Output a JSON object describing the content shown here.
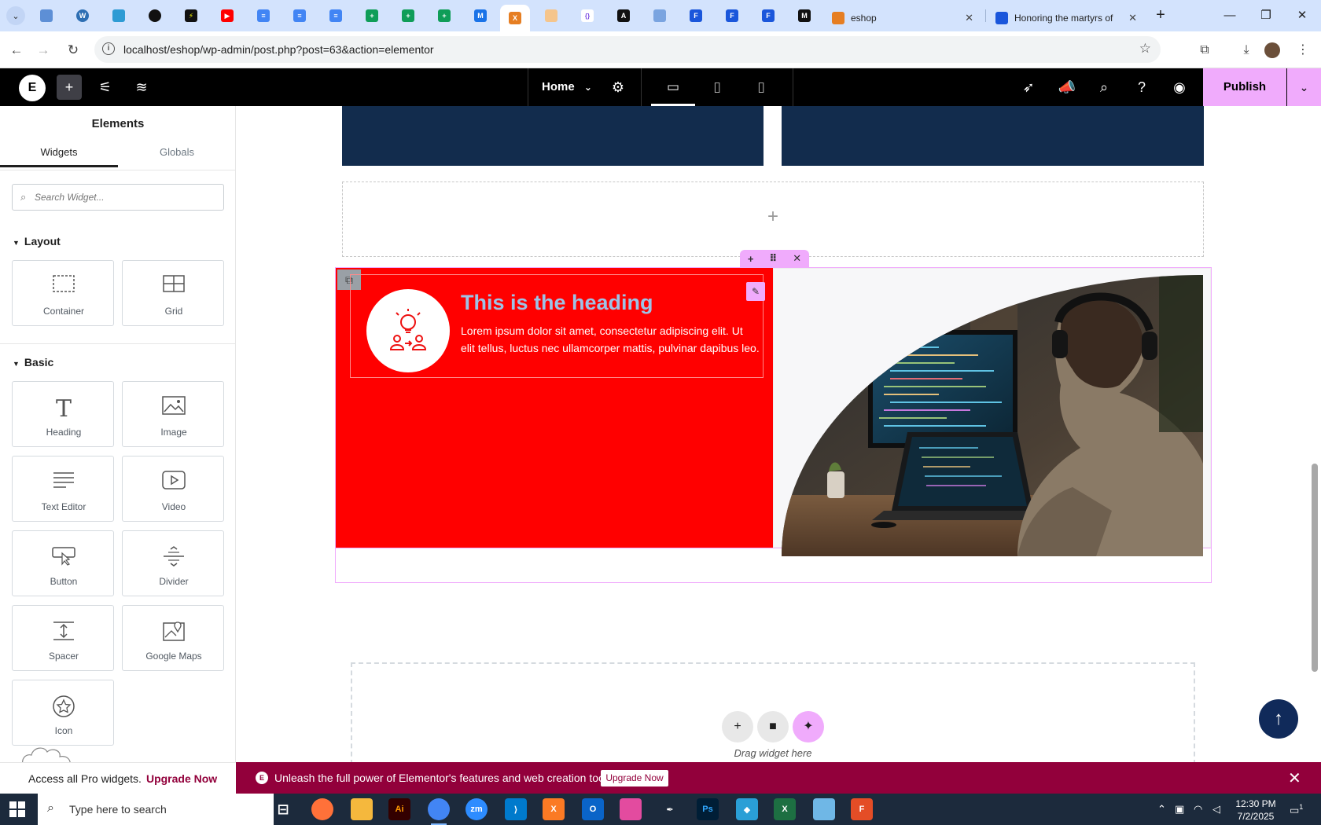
{
  "browser": {
    "tabs": [
      {
        "title": "eshop"
      },
      {
        "title": "Honoring the martyrs of"
      }
    ],
    "url": "localhost/eshop/wp-admin/post.php?post=63&action=elementor",
    "new_tab_glyph": "+"
  },
  "editor": {
    "page_name": "Home",
    "publish_label": "Publish"
  },
  "panel": {
    "title": "Elements",
    "tabs": [
      "Widgets",
      "Globals"
    ],
    "search_placeholder": "Search Widget...",
    "categories": {
      "layout": "Layout",
      "basic": "Basic"
    },
    "layout_widgets": [
      {
        "label": "Container",
        "icon": "container-icon"
      },
      {
        "label": "Grid",
        "icon": "grid-icon"
      }
    ],
    "basic_widgets": [
      {
        "label": "Heading",
        "icon": "heading-icon"
      },
      {
        "label": "Image",
        "icon": "image-icon"
      },
      {
        "label": "Text Editor",
        "icon": "text-editor-icon"
      },
      {
        "label": "Video",
        "icon": "video-icon"
      },
      {
        "label": "Button",
        "icon": "button-icon"
      },
      {
        "label": "Divider",
        "icon": "divider-icon"
      },
      {
        "label": "Spacer",
        "icon": "spacer-icon"
      },
      {
        "label": "Google Maps",
        "icon": "google-maps-icon"
      },
      {
        "label": "Icon",
        "icon": "star-icon"
      }
    ],
    "pro_text": "Access all Pro widgets.",
    "pro_link": "Upgrade Now"
  },
  "canvas": {
    "iconbox_heading": "This is the heading",
    "iconbox_text": "Lorem ipsum dolor sit amet, consectetur adipiscing elit. Ut elit tellus, luctus nec ullamcorper mattis, pulvinar dapibus leo.",
    "drop_label": "Drag widget here"
  },
  "promo": {
    "text": "Unleash the full power of Elementor's features and web creation tools.",
    "button": "Upgrade Now"
  },
  "taskbar": {
    "search_placeholder": "Type here to search",
    "time": "12:30 PM",
    "date": "7/2/2025",
    "notification_count": "1"
  },
  "colors": {
    "accent": "#f0abfc",
    "red_column": "#ff0000",
    "navy": "#122c4d",
    "promo": "#92003b",
    "heading": "#9ec2e6"
  }
}
